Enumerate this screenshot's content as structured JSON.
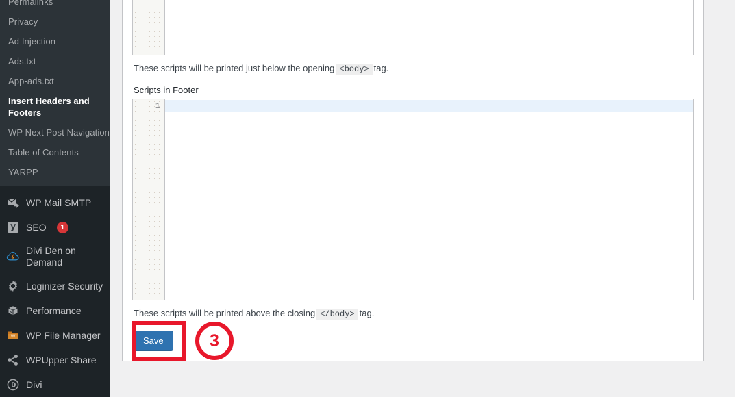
{
  "sidebar": {
    "submenu_items": [
      {
        "label": "Permalinks",
        "current": false,
        "clipped": true
      },
      {
        "label": "Privacy",
        "current": false
      },
      {
        "label": "Ad Injection",
        "current": false
      },
      {
        "label": "Ads.txt",
        "current": false
      },
      {
        "label": "App-ads.txt",
        "current": false
      },
      {
        "label": "Insert Headers and Footers",
        "current": true
      },
      {
        "label": "WP Next Post Navigation",
        "current": false
      },
      {
        "label": "Table of Contents",
        "current": false
      },
      {
        "label": "YARPP",
        "current": false
      }
    ],
    "menu_items": [
      {
        "label": "WP Mail SMTP",
        "icon": "mail-forward-icon",
        "badge": ""
      },
      {
        "label": "SEO",
        "icon": "yoast-seo-icon",
        "badge": "1"
      },
      {
        "label": "Divi Den on Demand",
        "icon": "cloud-bolt-icon",
        "badge": ""
      },
      {
        "label": "Loginizer Security",
        "icon": "gear-icon",
        "badge": ""
      },
      {
        "label": "Performance",
        "icon": "box-icon",
        "badge": ""
      },
      {
        "label": "WP File Manager",
        "icon": "folder-w-icon",
        "badge": ""
      },
      {
        "label": "WPUpper Share",
        "icon": "share-icon",
        "badge": ""
      },
      {
        "label": "Divi",
        "icon": "divi-d-icon",
        "badge": ""
      }
    ],
    "badge_color": "#d63638"
  },
  "main": {
    "header_editor": {
      "value": "",
      "line_number": ""
    },
    "header_hint": {
      "before": "These scripts will be printed just below the opening",
      "tag": "<body>",
      "after": "tag."
    },
    "footer_label": "Scripts in Footer",
    "footer_editor": {
      "value": "",
      "line_number": "1"
    },
    "footer_hint": {
      "before": "These scripts will be printed above the closing",
      "tag": "</body>",
      "after": "tag."
    },
    "save_label": "Save",
    "annotation_step": "3",
    "annotation_color": "#e8172b",
    "save_button_color": "#2e72b0"
  }
}
